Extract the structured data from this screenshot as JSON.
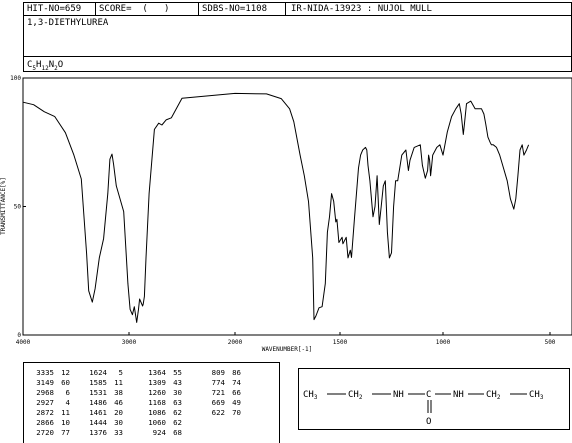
{
  "header": {
    "hit_no": "HIT-NO=659",
    "score": "SCORE=  (   )",
    "sdbs_no": "SDBS-NO=1108",
    "ir_id": "IR-NIDA-13923 : NUJOL MULL",
    "compound_name": "1,3-DIETHYLUREA",
    "formula": "C5H12N2O"
  },
  "chart_data": {
    "type": "line",
    "xlabel": "WAVENUMBER[-1]",
    "ylabel": "TRANSMITTANCE[%]",
    "xlim": [
      4000,
      600
    ],
    "ylim": [
      0,
      100
    ],
    "x_ticks": [
      "4000",
      "3000",
      "2000",
      "1500",
      "1000",
      "500"
    ],
    "y_ticks": [
      "100",
      "50",
      "0"
    ],
    "x_tick_values": [
      4000,
      3000,
      2000,
      1500,
      1000,
      500
    ],
    "y_tick_values": [
      100,
      50,
      0
    ],
    "grid": false,
    "series": [
      {
        "points": [
          [
            4000,
            90.6
          ],
          [
            3900,
            89.6
          ],
          [
            3800,
            86.9
          ],
          [
            3700,
            85.0
          ],
          [
            3600,
            78.7
          ],
          [
            3520,
            70.0
          ],
          [
            3450,
            60.7
          ],
          [
            3400,
            31.7
          ],
          [
            3380,
            17.2
          ],
          [
            3346,
            12.8
          ],
          [
            3320,
            18.0
          ],
          [
            3280,
            30.0
          ],
          [
            3240,
            37.5
          ],
          [
            3200,
            55.0
          ],
          [
            3180,
            68.4
          ],
          [
            3160,
            70.4
          ],
          [
            3145,
            66.4
          ],
          [
            3120,
            58.0
          ],
          [
            3050,
            48.0
          ],
          [
            3010,
            20.0
          ],
          [
            2990,
            10.0
          ],
          [
            2968,
            7.9
          ],
          [
            2950,
            11.0
          ],
          [
            2927,
            4.9
          ],
          [
            2910,
            10.0
          ],
          [
            2900,
            14.0
          ],
          [
            2872,
            11.3
          ],
          [
            2866,
            12.0
          ],
          [
            2855,
            15.0
          ],
          [
            2840,
            30.0
          ],
          [
            2810,
            55.0
          ],
          [
            2760,
            80.0
          ],
          [
            2720,
            82.4
          ],
          [
            2690,
            81.7
          ],
          [
            2650,
            83.7
          ],
          [
            2600,
            84.5
          ],
          [
            2500,
            92.1
          ],
          [
            2000,
            94.0
          ],
          [
            1850,
            93.8
          ],
          [
            1780,
            92.0
          ],
          [
            1740,
            88.0
          ],
          [
            1720,
            83.0
          ],
          [
            1690,
            70.0
          ],
          [
            1670,
            62.0
          ],
          [
            1650,
            52.0
          ],
          [
            1630,
            30.0
          ],
          [
            1624,
            6.0
          ],
          [
            1615,
            7.4
          ],
          [
            1600,
            10.6
          ],
          [
            1585,
            11.0
          ],
          [
            1570,
            20.0
          ],
          [
            1560,
            40.0
          ],
          [
            1550,
            46.0
          ],
          [
            1540,
            55.0
          ],
          [
            1530,
            52.0
          ],
          [
            1520,
            44.0
          ],
          [
            1515,
            45.0
          ],
          [
            1505,
            36.0
          ],
          [
            1490,
            38.0
          ],
          [
            1486,
            35.5
          ],
          [
            1470,
            38.0
          ],
          [
            1461,
            30.0
          ],
          [
            1450,
            33.0
          ],
          [
            1444,
            30.2
          ],
          [
            1430,
            45.0
          ],
          [
            1410,
            65.0
          ],
          [
            1400,
            70.0
          ],
          [
            1390,
            72.0
          ],
          [
            1376,
            73.0
          ],
          [
            1370,
            72.0
          ],
          [
            1364,
            66.0
          ],
          [
            1355,
            60.0
          ],
          [
            1340,
            46.0
          ],
          [
            1330,
            50.0
          ],
          [
            1320,
            62.0
          ],
          [
            1310,
            45.0
          ],
          [
            1309,
            43.0
          ],
          [
            1300,
            50.0
          ],
          [
            1290,
            58.0
          ],
          [
            1280,
            60.0
          ],
          [
            1270,
            40.0
          ],
          [
            1260,
            30.0
          ],
          [
            1250,
            32.0
          ],
          [
            1240,
            50.0
          ],
          [
            1230,
            60.0
          ],
          [
            1220,
            60.0
          ],
          [
            1200,
            70.0
          ],
          [
            1180,
            72.0
          ],
          [
            1168,
            64.0
          ],
          [
            1160,
            68.0
          ],
          [
            1140,
            73.0
          ],
          [
            1110,
            74.0
          ],
          [
            1100,
            66.0
          ],
          [
            1086,
            61.0
          ],
          [
            1075,
            64.0
          ],
          [
            1070,
            70.0
          ],
          [
            1065,
            68.0
          ],
          [
            1060,
            62.0
          ],
          [
            1055,
            66.0
          ],
          [
            1050,
            70.0
          ],
          [
            1030,
            73.0
          ],
          [
            1015,
            74.0
          ],
          [
            1000,
            70.0
          ],
          [
            980,
            79.0
          ],
          [
            960,
            85.0
          ],
          [
            940,
            88.0
          ],
          [
            924,
            90.0
          ],
          [
            915,
            86.0
          ],
          [
            905,
            78.0
          ],
          [
            900,
            82.0
          ],
          [
            890,
            90.0
          ],
          [
            870,
            91.0
          ],
          [
            850,
            88.0
          ],
          [
            820,
            88.0
          ],
          [
            809,
            86.0
          ],
          [
            800,
            82.0
          ],
          [
            790,
            77.0
          ],
          [
            780,
            75.0
          ],
          [
            774,
            74.0
          ],
          [
            765,
            74.0
          ],
          [
            750,
            73.0
          ],
          [
            735,
            70.0
          ],
          [
            721,
            66.0
          ],
          [
            700,
            60.0
          ],
          [
            685,
            53.0
          ],
          [
            669,
            49.0
          ],
          [
            660,
            53.0
          ],
          [
            650,
            62.0
          ],
          [
            640,
            72.0
          ],
          [
            630,
            74.0
          ],
          [
            622,
            70.0
          ],
          [
            610,
            72.0
          ],
          [
            600,
            74.0
          ]
        ]
      }
    ]
  },
  "peak_table": {
    "columns": [
      [
        [
          "3335",
          "12"
        ],
        [
          "3149",
          "60"
        ],
        [
          "2968",
          "6"
        ],
        [
          "2927",
          "4"
        ],
        [
          "2872",
          "11"
        ],
        [
          "2866",
          "10"
        ],
        [
          "2720",
          "77"
        ]
      ],
      [
        [
          "1624",
          "5"
        ],
        [
          "1585",
          "11"
        ],
        [
          "1531",
          "38"
        ],
        [
          "1486",
          "46"
        ],
        [
          "1461",
          "20"
        ],
        [
          "1444",
          "30"
        ],
        [
          "1376",
          "33"
        ]
      ],
      [
        [
          "1364",
          "55"
        ],
        [
          "1309",
          "43"
        ],
        [
          "1260",
          "30"
        ],
        [
          "1168",
          "63"
        ],
        [
          "1086",
          "62"
        ],
        [
          "1060",
          "62"
        ],
        [
          "924",
          "68"
        ]
      ],
      [
        [
          "809",
          "86"
        ],
        [
          "774",
          "74"
        ],
        [
          "721",
          "66"
        ],
        [
          "669",
          "49"
        ],
        [
          "622",
          "70"
        ]
      ]
    ]
  },
  "structure": {
    "ch3_left": "CH3",
    "ch2_left": "CH2",
    "nh_left": "NH",
    "carbon": "C",
    "nh_right": "NH",
    "ch2_right": "CH2",
    "ch3_right": "CH3",
    "oxygen": "O"
  }
}
